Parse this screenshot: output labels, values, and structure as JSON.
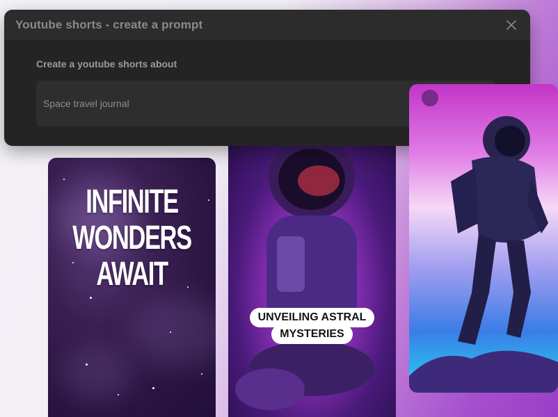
{
  "dialog": {
    "title": "Youtube shorts - create a prompt",
    "close_icon": "close-icon",
    "field_label": "Create a youtube shorts about",
    "input_value": "Space travel journal",
    "input_placeholder": ""
  },
  "cards": [
    {
      "caption": "INFINITE\nWONDERS\nAWAIT",
      "line1": "INFINITE",
      "line2": "WONDERS",
      "line3": "AWAIT"
    },
    {
      "line1": "UNVEILING ASTRAL",
      "line2": "MYSTERIES"
    },
    {
      "caption": ""
    }
  ],
  "colors": {
    "dialog_bg": "#242424",
    "accent_purple": "#9a3fc6",
    "caption_pill_bg": "#ffffff"
  }
}
